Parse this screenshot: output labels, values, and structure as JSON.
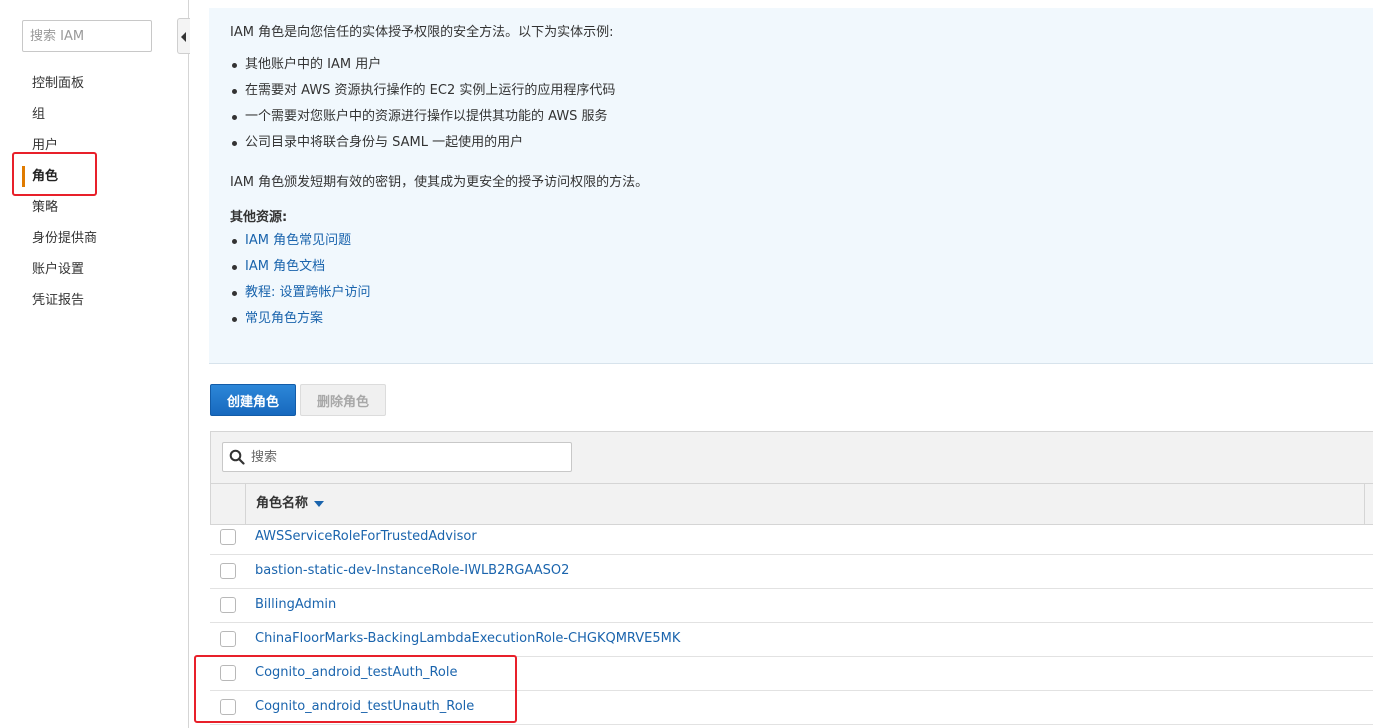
{
  "sidebar": {
    "search_placeholder": "搜索 IAM",
    "items": [
      {
        "label": "控制面板"
      },
      {
        "label": "组"
      },
      {
        "label": "用户"
      },
      {
        "label": "角色"
      },
      {
        "label": "策略"
      },
      {
        "label": "身份提供商"
      },
      {
        "label": "账户设置"
      },
      {
        "label": "凭证报告"
      }
    ],
    "active_item": "角色"
  },
  "info_panel": {
    "intro": "IAM 角色是向您信任的实体授予权限的安全方法。以下为实体示例:",
    "examples": [
      "其他账户中的 IAM 用户",
      "在需要对 AWS 资源执行操作的 EC2 实例上运行的应用程序代码",
      "一个需要对您账户中的资源进行操作以提供其功能的 AWS 服务",
      "公司目录中将联合身份与 SAML 一起使用的用户"
    ],
    "summary": "IAM 角色颁发短期有效的密钥，使其成为更安全的授予访问权限的方法。",
    "resources_heading": "其他资源:",
    "resources": [
      "IAM 角色常见问题",
      "IAM 角色文档",
      "教程: 设置跨帐户访问",
      "常见角色方案"
    ]
  },
  "actions": {
    "create_label": "创建角色",
    "delete_label": "删除角色"
  },
  "table": {
    "search_placeholder": "搜索",
    "column_name": "角色名称",
    "rows": [
      "AWSServiceRoleForTrustedAdvisor",
      "bastion-static-dev-InstanceRole-IWLB2RGAASO2",
      "BillingAdmin",
      "ChinaFloorMarks-BackingLambdaExecutionRole-CHGKQMRVE5MK",
      "Cognito_android_testAuth_Role",
      "Cognito_android_testUnauth_Role"
    ]
  },
  "colors": {
    "link": "#1a64ad",
    "primary_button": "#1f74c8",
    "active_marker": "#e07b00",
    "highlight_box": "#e8202a",
    "info_background": "#f1f8fd"
  }
}
